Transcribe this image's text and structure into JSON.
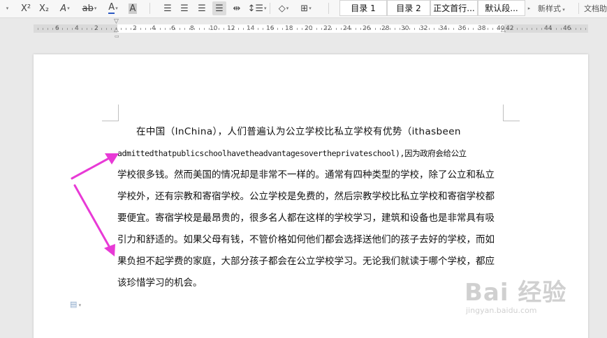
{
  "toolbar": {
    "superscript_label": "X²",
    "subscript_label": "X₂",
    "font_effect_label": "A",
    "highlight_label": "ab",
    "font_color_label": "A",
    "char_shading_label": "A",
    "styles": [
      {
        "label": "目录 1"
      },
      {
        "label": "目录 2"
      },
      {
        "label": "正文首行..."
      },
      {
        "label": "默认段..."
      }
    ],
    "new_style_label": "新样式",
    "doc_helper_label": "文档助"
  },
  "ruler": {
    "numbers": [
      "6",
      "4",
      "2",
      "2",
      "4",
      "6",
      "8",
      "10",
      "12",
      "14",
      "16",
      "18",
      "20",
      "22",
      "24",
      "26",
      "28",
      "30",
      "32",
      "34",
      "36",
      "38",
      "40",
      "42",
      "44",
      "46"
    ]
  },
  "document": {
    "lines": [
      "在中国（InChina），人们普遍认为公立学校比私立学校有优势（ithasbeen",
      "admittedthatpublicschoolhavetheadvantagesovertheprivateschool),因为政府会给公立",
      "学校很多钱。然而美国的情况却是非常不一样的。通常有四种类型的学校，除了公立和私立",
      "学校外，还有宗教和寄宿学校。公立学校是免费的，然后宗教学校比私立学校和寄宿学校都",
      "要便宜。寄宿学校是最昂贵的，很多名人都在这样的学校学习，建筑和设备也是非常具有吸",
      "引力和舒适的。如果父母有钱，不管价格如何他们都会选择送他们的孩子去好的学校，而如",
      "果负担不起学费的家庭，大部分孩子都会在公立学校学习。无论我们就读于哪个学校，都应",
      "该珍惜学习的机会。"
    ]
  },
  "annotation": {
    "arrow_color": "#e83ad6"
  },
  "watermark": {
    "brand": "Bai 经验",
    "url": "jingyan.baidu.com"
  }
}
